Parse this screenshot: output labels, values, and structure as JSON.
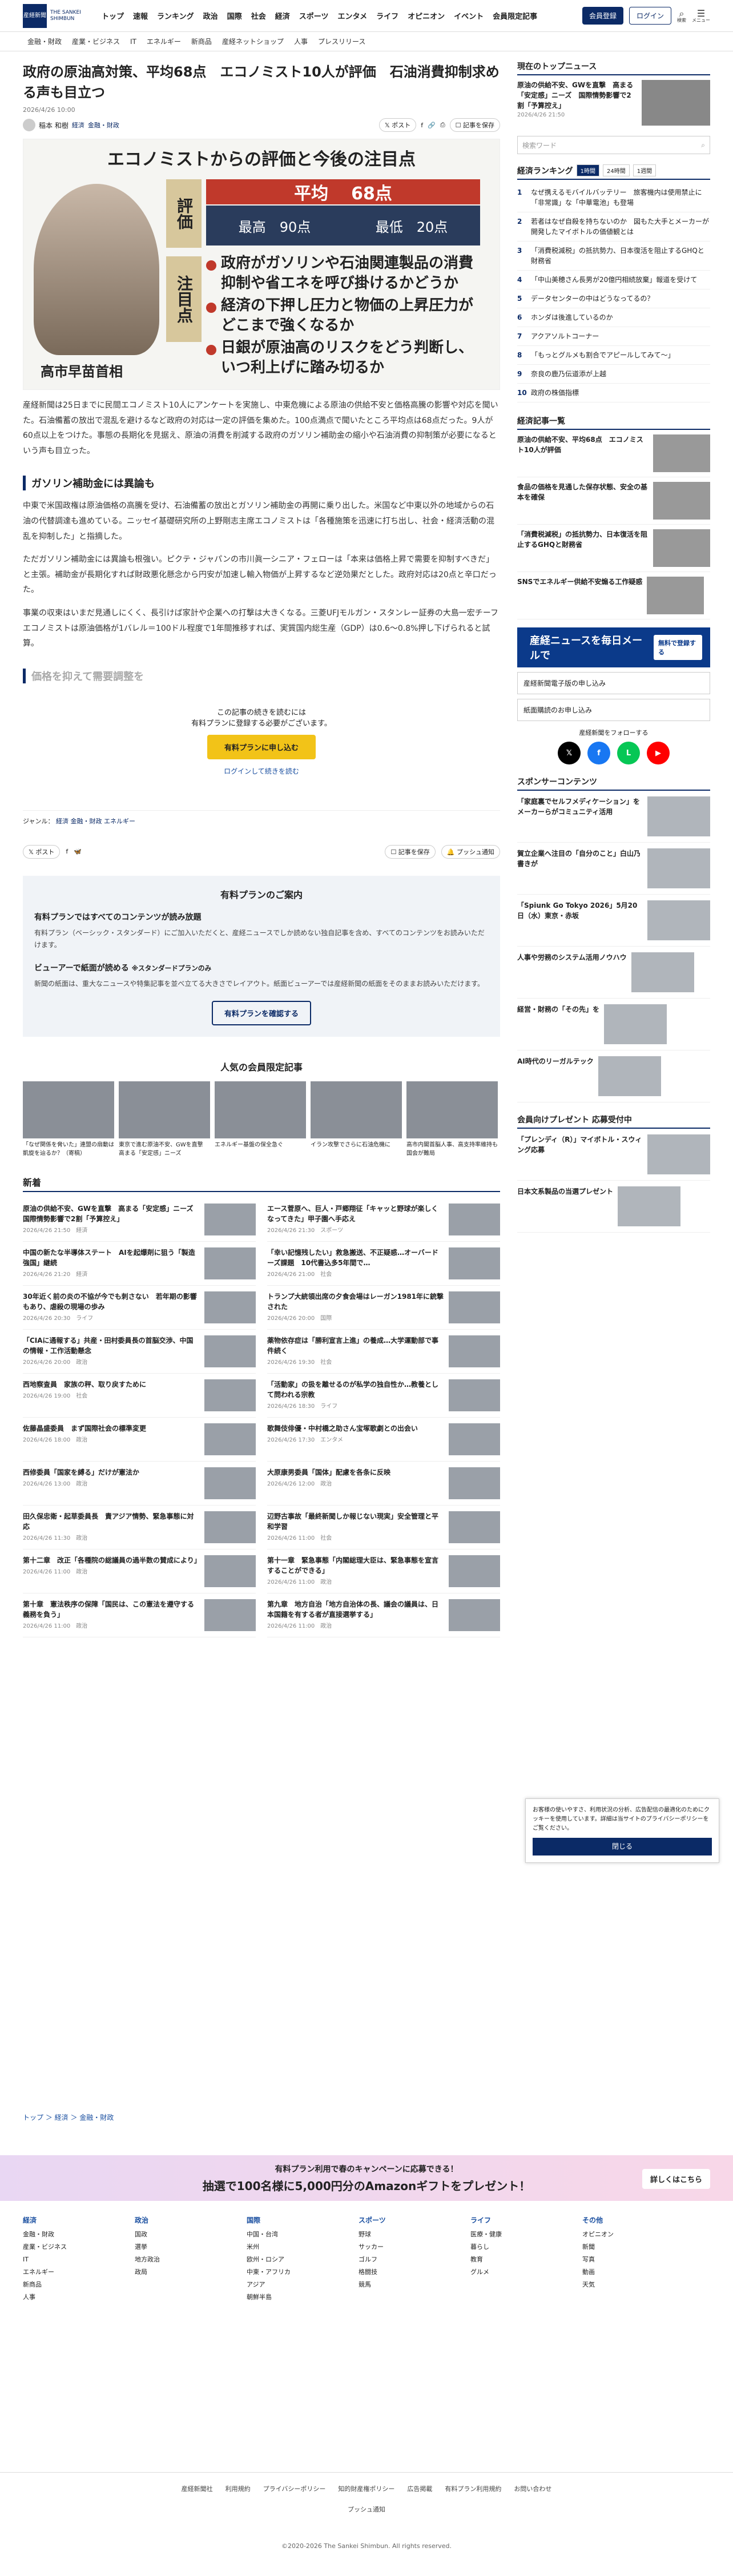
{
  "header": {
    "logo": "産経新聞",
    "logo_sub": "THE SANKEI SHIMBUN",
    "nav": [
      "トップ",
      "速報",
      "ランキング",
      "政治",
      "国際",
      "社会",
      "経済",
      "スポーツ",
      "エンタメ",
      "ライフ",
      "オピニオン",
      "イベント",
      "会員限定記事"
    ],
    "member_btn": "会員登録",
    "login_btn": "ログイン",
    "search_label": "検索",
    "menu_label": "メニュー"
  },
  "subnav": [
    "金融・財政",
    "産業・ビジネス",
    "IT",
    "エネルギー",
    "新商品",
    "産経ネットショップ",
    "人事",
    "プレスリリース"
  ],
  "article": {
    "title": "政府の原油高対策、平均68点　エコノミスト10人が評価　石油消費抑制求める声も目立つ",
    "date": "2026/4/26 10:00",
    "author": "稲本 和樹",
    "tags": [
      "経済",
      "金融・財政"
    ],
    "share_post": "ポスト",
    "save": "記事を保存",
    "hero": {
      "title": "エコノミストからの評価と今後の注目点",
      "label1": "評価",
      "label2": "注目点",
      "avg_label": "平均",
      "avg": "68点",
      "max_label": "最高",
      "max": "90点",
      "min_label": "最低",
      "min": "20点",
      "points": [
        "政府がガソリンや石油関連製品の消費抑制や省エネを呼び掛けるかどうか",
        "経済の下押し圧力と物価の上昇圧力がどこまで強くなるか",
        "日銀が原油高のリスクをどう判断し、いつ利上げに踏み切るか"
      ],
      "person": "高市早苗首相"
    },
    "paras": [
      "産経新聞は25日までに民間エコノミスト10人にアンケートを実施し、中東危機による原油の供給不安と価格高騰の影響や対応を聞いた。石油備蓄の放出で混乱を避けるなど政府の対応は一定の評価を集めた。100点満点で聞いたところ平均点は68点だった。9人が60点以上をつけた。事態の長期化を見据え、原油の消費を削減する政府のガソリン補助金の縮小や石油消費の抑制策が必要になるという声も目立った。"
    ],
    "h2": "ガソリン補助金には異論も",
    "paras2": [
      "中東で米国政権は原油価格の高騰を受け、石油備蓄の放出とガソリン補助金の再開に乗り出した。米国など中東以外の地域からの石油の代替調達も進めている。ニッセイ基礎研究所の上野剛志主席エコノミストは「各種施策を迅速に打ち出し、社会・経済活動の混乱を抑制した」と指摘した。",
      "ただガソリン補助金には異論も根強い。ピクテ・ジャパンの市川眞一シニア・フェローは「本来は価格上昇で需要を抑制すべきだ」と主張。補助金が長期化すれば財政悪化懸念から円安が加速し輸入物価が上昇するなど逆効果だとした。政府対応は20点と辛口だった。"
    ],
    "para_fade": "事業の収束はいまだ見通しにくく、長引けば家計や企業への打撃は大きくなる。三菱UFJモルガン・スタンレー証券の大島一宏チーフエコノミストは原油価格が1バレル＝100ドル程度で1年間推移すれば、実質国内総生産（GDP）は0.6～0.8%押し下げられると試算。",
    "h2_fade": "価格を抑えて需要調整を",
    "paywall": {
      "l1": "この記事の続きを読むには",
      "l2": "有料プランに登録する必要がございます。",
      "btn": "有料プランに申し込む",
      "login": "ログインして続きを読む"
    },
    "genre_label": "ジャンル：",
    "genre": [
      "経済",
      "金融・財政",
      "エネルギー"
    ],
    "push": "プッシュ通知"
  },
  "plan": {
    "title": "有料プランのご案内",
    "h1": "有料プランではすべてのコンテンツが読み放題",
    "p1": "有料プラン（ベーシック・スタンダード）にご加入いただくと、産経ニュースでしか読めない独自記事を含め、すべてのコンテンツをお読みいただけます。",
    "h2": "ビューアーで紙面が読める",
    "h2s": "※スタンダードプランのみ",
    "p2": "新聞の紙面は、重大なニュースや特集記事を並べ立てる大きさでレイアウト。紙面ビューアーでは産経新聞の紙面をそのままお読みいただけます。",
    "btn": "有料プランを確認する"
  },
  "popular": {
    "title": "人気の会員限定記事",
    "items": [
      "「なぜ関係を脅いた」連盟の扇動は凱旋を辿るか？（寄稿）",
      "東京で進む原油不安、GWを直撃　高まる「安定感」ニーズ",
      "エネルギー基盤の保全急ぐ",
      "イラン攻撃でさらに石油危機に",
      "高市内閣首脳人事、高支持率維持も国会が難局"
    ]
  },
  "news": {
    "title": "新着",
    "items": [
      {
        "t": "原油の供給不安、GWを直撃　高まる「安定感」ニーズ　国際情勢影響で2割「予算控え」",
        "d": "2026/4/26 21:50",
        "c": "経済"
      },
      {
        "t": "エース菅原へ、巨人・戸郷翔征「キャッと野球が楽しくなってきた」甲子園へ手応え",
        "d": "2026/4/26 21:30",
        "c": "スポーツ"
      },
      {
        "t": "中国の新たな半導体ステート　AIを起爆剤に狙う「製造強国」継続",
        "d": "2026/4/26 21:20",
        "c": "経済"
      },
      {
        "t": "「幸い記憶残したい」救急搬送、不正疑惑…オーバードーズ課題　10代書込多5年間で…",
        "d": "2026/4/26 21:00",
        "c": "社会"
      },
      {
        "t": "30年近く前の炎の不協が今でも刺さない　若年期の影響もあり、虐殺の現場の歩み",
        "d": "2026/4/26 20:30",
        "c": "ライフ"
      },
      {
        "t": "トランプ大統領出席の夕食会場はレーガン1981年に銃撃された",
        "d": "2026/4/26 20:00",
        "c": "国際"
      },
      {
        "t": "「CIAに通報する」共産・田村委員長の首脳交渉、中国の情報・工作活動懸念",
        "d": "2026/4/26 20:00",
        "c": "政治"
      },
      {
        "t": "薬物依存症は「勝利宣言上進」の養成…大学運動部で事件続く",
        "d": "2026/4/26 19:30",
        "c": "社会"
      },
      {
        "t": "西地察査員　家族の秤、取り戻すために",
        "d": "2026/4/26 19:00",
        "c": "社会"
      },
      {
        "t": "「活動家」の扱を離せるのが私学の独自性か…教養として問われる宗教",
        "d": "2026/4/26 18:30",
        "c": "ライフ"
      },
      {
        "t": "佐藤晶盛委員　まず国際社会の標準変更",
        "d": "2026/4/26 18:00",
        "c": "政治"
      },
      {
        "t": "歌舞伎俳優・中村橋之助さん宝塚歌劇との出会い",
        "d": "2026/4/26 17:30",
        "c": "エンタメ"
      },
      {
        "t": "西修委員「国家を縛る」だけが憲法か",
        "d": "2026/4/26 13:00",
        "c": "政治"
      },
      {
        "t": "大原康男委員「国体」配慮を各条に反映",
        "d": "2026/4/26 12:00",
        "c": "政治"
      },
      {
        "t": "田久保忠衛・起草委員長　責アジア情勢、緊急事態に対応",
        "d": "2026/4/26 11:30",
        "c": "政治"
      },
      {
        "t": "辺野古事故「最終新聞しか報じない現実」安全管理と平和学習",
        "d": "2026/4/26 11:00",
        "c": "社会"
      },
      {
        "t": "第十二章　改正「各種院の総議員の過半数の賛成により」",
        "d": "2026/4/26 11:00",
        "c": "政治"
      },
      {
        "t": "第十一章　緊急事態「内閣総理大臣は、緊急事態を宣言することができる」",
        "d": "2026/4/26 11:00",
        "c": "政治"
      },
      {
        "t": "第十章　憲法秩序の保障「国民は、この憲法を遵守する義務を負う」",
        "d": "2026/4/26 11:00",
        "c": "政治"
      },
      {
        "t": "第九章　地方自治「地方自治体の長、議会の議員は、日本国籍を有する者が直接選挙する」",
        "d": "2026/4/26 11:00",
        "c": "政治"
      }
    ]
  },
  "side": {
    "top_title": "現在のトップニュース",
    "top_feat": "原油の供給不安、GWを直撃　高まる「安定感」ニーズ　国際情勢影響で2割「予算控え」",
    "top_date": "2026/4/26 21:50",
    "search_ph": "検索ワード",
    "rank_title": "経済ランキング",
    "rank_tabs": [
      "1時間",
      "24時間",
      "1週間"
    ],
    "rank": [
      "なぜ携えるモバイルバッテリー　旅客機内は使用禁止に　「非常識」な「中華電池」も登場",
      "若者はなぜ自殺を持ちないのか　図もた大手とメーカーが開発したマイボトルの価値観とは",
      "「消費税減税」の抵抗勢力、日本復活を阻止するGHQと財務省",
      "「中山美穂さん長男が20億円相続放棄」報道を受けて",
      "データセンターの中はどうなってるの？",
      "ホンダは後進しているのか",
      "アクアソルトコーナー",
      "「もっとグルメも割合でアピールしてみて～」",
      "奈良の鹿乃伝道添が上越",
      "政府の株価指標"
    ],
    "recommend_title": "経済記事一覧",
    "rec": [
      "原油の供給不安、平均68点　エコノミスト10人が評価",
      "食品の価格を見通した保存状態、安全の基本を確保",
      "「消費税減税」の抵抗勢力、日本復活を阻止するGHQと財務省",
      "SNSでエネルギー供給不安煽る工作疑惑"
    ],
    "banner": "産経ニュースを毎日メールで",
    "banner_btn": "無料で登録する",
    "btn1": "産経新聞電子版の申し込み",
    "btn2": "紙面購読のお申し込み",
    "follow": "産経新聞をフォローする",
    "spon_title": "スポンサーコンテンツ",
    "spon": [
      "「家庭裏でセルフメディケーション」を　メーカーらがコミュニティ活用",
      "賀立企業へ注目の「自分のこと」白山乃書きが",
      "「Spiunk Go Tokyo 2026」5月20日（水）東京・赤坂",
      "人事や労務のシステム活用ノウハウ",
      "経営・財務の「その先」を",
      "AI時代のリーガルテック"
    ],
    "present_title": "会員向けプレゼント 応募受付中",
    "present": [
      "「プレンディ（R）」マイボトル・スウィング応募",
      "日本文系製品の当選プレゼント"
    ]
  },
  "cookie": {
    "text": "お客様の使いやすさ、利用状況の分析、広告配信の最適化のためにクッキーを使用しています。詳細は当サイトのプライバシーポリシーをご覧ください。",
    "btn": "閉じる"
  },
  "breadcrumb": "トップ ＞ 経済 ＞ 金融・財政",
  "promo": {
    "l1": "有料プラン利用で春のキャンペーンに応募できる！",
    "l2": "抽選で100名様に5,000円分のAmazonギフトをプレゼント！",
    "more": "詳しくはこちら"
  },
  "sitemap": [
    {
      "h": "経済",
      "items": [
        "金融・財政",
        "産業・ビジネス",
        "IT",
        "エネルギー",
        "新商品",
        "人事"
      ]
    },
    {
      "h": "政治",
      "items": [
        "国政",
        "選挙",
        "地方政治",
        "政局"
      ]
    },
    {
      "h": "国際",
      "items": [
        "中国・台湾",
        "米州",
        "欧州・ロシア",
        "中東・アフリカ",
        "アジア",
        "朝鮮半島"
      ]
    },
    {
      "h": "スポーツ",
      "items": [
        "野球",
        "サッカー",
        "ゴルフ",
        "格闘技",
        "競馬"
      ]
    },
    {
      "h": "ライフ",
      "items": [
        "医療・健康",
        "暮らし",
        "教育",
        "グルメ"
      ]
    },
    {
      "h": "その他",
      "items": [
        "オピニオン",
        "新聞",
        "写真",
        "動画",
        "天気"
      ]
    }
  ],
  "footer": {
    "links": [
      "産経新聞社",
      "利用規約",
      "プライバシーポリシー",
      "知的財産権ポリシー",
      "広告掲載",
      "有料プラン利用規約",
      "お問い合わせ"
    ],
    "push": "プッシュ通知",
    "copy": "©2020-2026 The Sankei Shimbun. All rights reserved."
  }
}
